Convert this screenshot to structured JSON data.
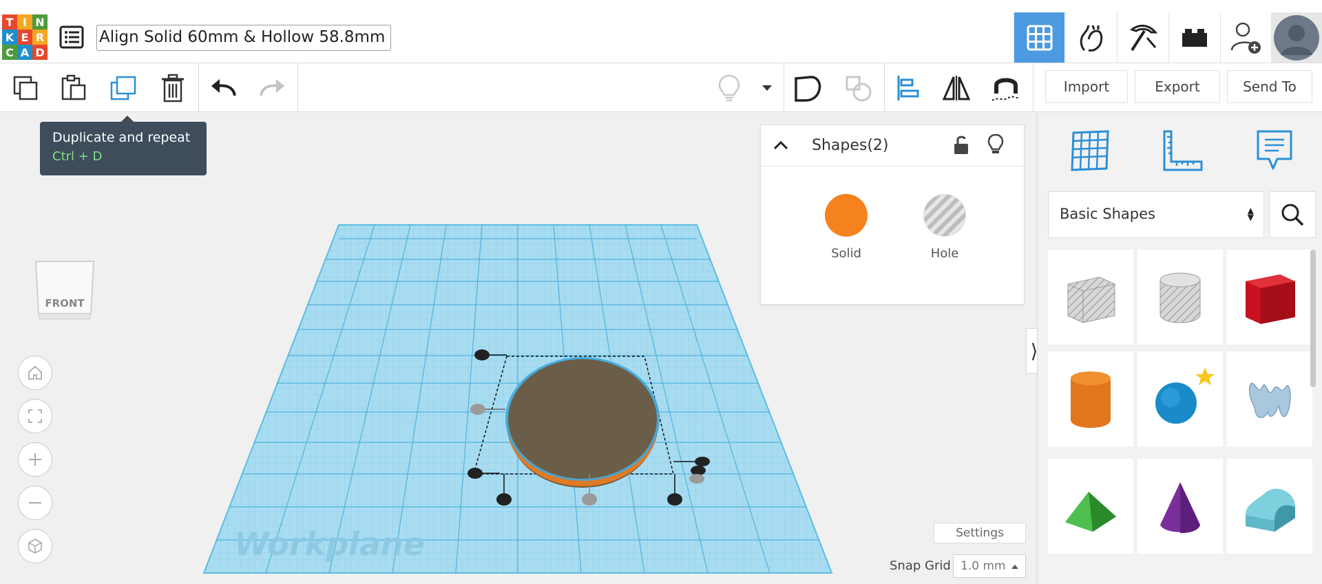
{
  "header": {
    "logo_letters": [
      "T",
      "I",
      "N",
      "K",
      "E",
      "R",
      "C",
      "A",
      "D"
    ],
    "logo_colors": [
      "#e8472d",
      "#f6a623",
      "#4d9b3d",
      "#1f8ece",
      "#e8472d",
      "#f6a623",
      "#4d9b3d",
      "#1f8ece",
      "#e8472d"
    ],
    "design_title": "Align Solid 60mm & Hollow 58.8mm",
    "nav_icons": [
      "3d-grid-icon",
      "hand-gesture-icon",
      "pickaxe-icon",
      "bricks-icon",
      "add-user-icon",
      "avatar"
    ]
  },
  "toolbar": {
    "import_label": "Import",
    "export_label": "Export",
    "send_to_label": "Send To"
  },
  "tooltip": {
    "title": "Duplicate and repeat",
    "shortcut": "Ctrl + D"
  },
  "viewport": {
    "view_cube_label": "FRONT",
    "workplane_label": "Workplane",
    "settings_label": "Settings",
    "snap_grid_label": "Snap Grid",
    "snap_grid_value": "1.0 mm"
  },
  "shapes_panel": {
    "title": "Shapes(2)",
    "solid_label": "Solid",
    "hole_label": "Hole",
    "solid_color": "#f5821f"
  },
  "library": {
    "category": "Basic Shapes",
    "shapes": [
      "box-hole",
      "cylinder-hole",
      "box",
      "cylinder",
      "sphere",
      "scribble",
      "roof",
      "cone",
      "round-roof"
    ]
  }
}
